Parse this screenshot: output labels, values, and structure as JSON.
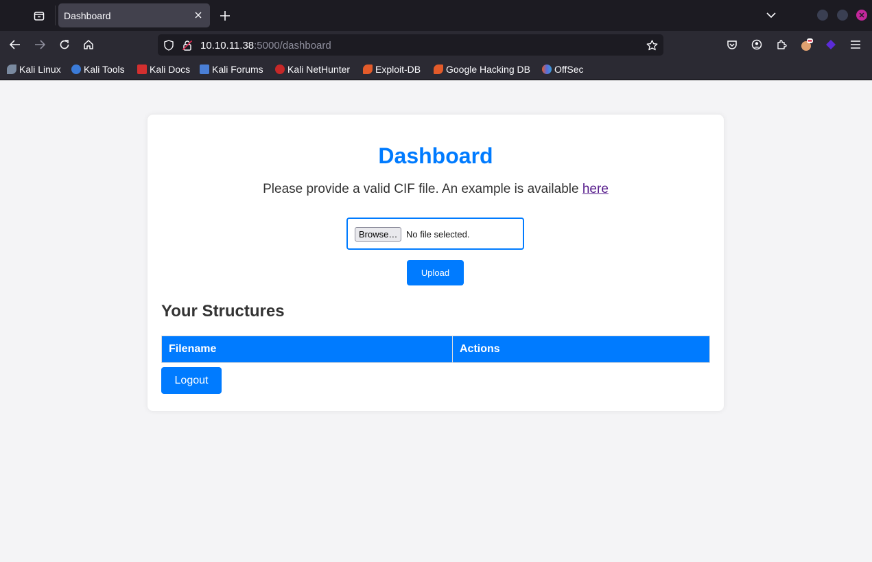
{
  "browser": {
    "tab": {
      "title": "Dashboard"
    },
    "url": {
      "host": "10.10.11.38",
      "rest": ":5000/dashboard"
    },
    "bookmarks": [
      {
        "label": "Kali Linux",
        "icon": "kali-dragon-icon",
        "color": "#7a8aa0"
      },
      {
        "label": "Kali Tools",
        "icon": "kali-tools-icon",
        "color": "#3b7bd8"
      },
      {
        "label": "Kali Docs",
        "icon": "kali-docs-icon",
        "color": "#d32f2f"
      },
      {
        "label": "Kali Forums",
        "icon": "kali-forums-icon",
        "color": "#4a7fd6"
      },
      {
        "label": "Kali NetHunter",
        "icon": "kali-nethunter-icon",
        "color": "#c62828"
      },
      {
        "label": "Exploit-DB",
        "icon": "exploit-db-icon",
        "color": "#e35b2a"
      },
      {
        "label": "Google Hacking DB",
        "icon": "ghdb-icon",
        "color": "#e35b2a"
      },
      {
        "label": "OffSec",
        "icon": "offsec-icon",
        "color": "#5a6bd8"
      }
    ]
  },
  "page": {
    "title": "Dashboard",
    "intro_text": "Please provide a valid CIF file. An example is available ",
    "intro_link": "here",
    "file_input": {
      "button_label": "Browse…",
      "status": "No file selected."
    },
    "upload_label": "Upload",
    "structures_heading": "Your Structures",
    "table": {
      "columns": [
        "Filename",
        "Actions"
      ],
      "rows": []
    },
    "logout_label": "Logout",
    "accent_color": "#007bff"
  }
}
